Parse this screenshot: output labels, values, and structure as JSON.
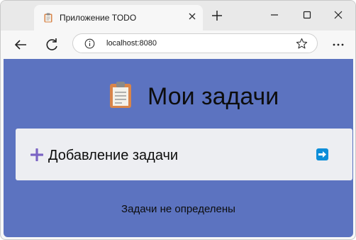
{
  "browser": {
    "tab_title": "Приложение TODO",
    "url": "localhost:8080",
    "tab_favicon": "clipboard-icon",
    "icons": [
      "close-icon",
      "plus-icon",
      "minimize-icon",
      "maximize-icon",
      "back-arrow-icon",
      "reload-icon",
      "info-icon",
      "star-icon",
      "more-icon"
    ]
  },
  "app": {
    "header_icon": "clipboard-icon",
    "title": "Мои задачи",
    "add_placeholder": "Добавление задачи",
    "empty_message": "Задачи не определены",
    "colors": {
      "background": "#5c73c0",
      "input_panel": "#edeef2",
      "plus_icon": "#7b64c4",
      "submit_button": "#0d8ed9"
    }
  }
}
